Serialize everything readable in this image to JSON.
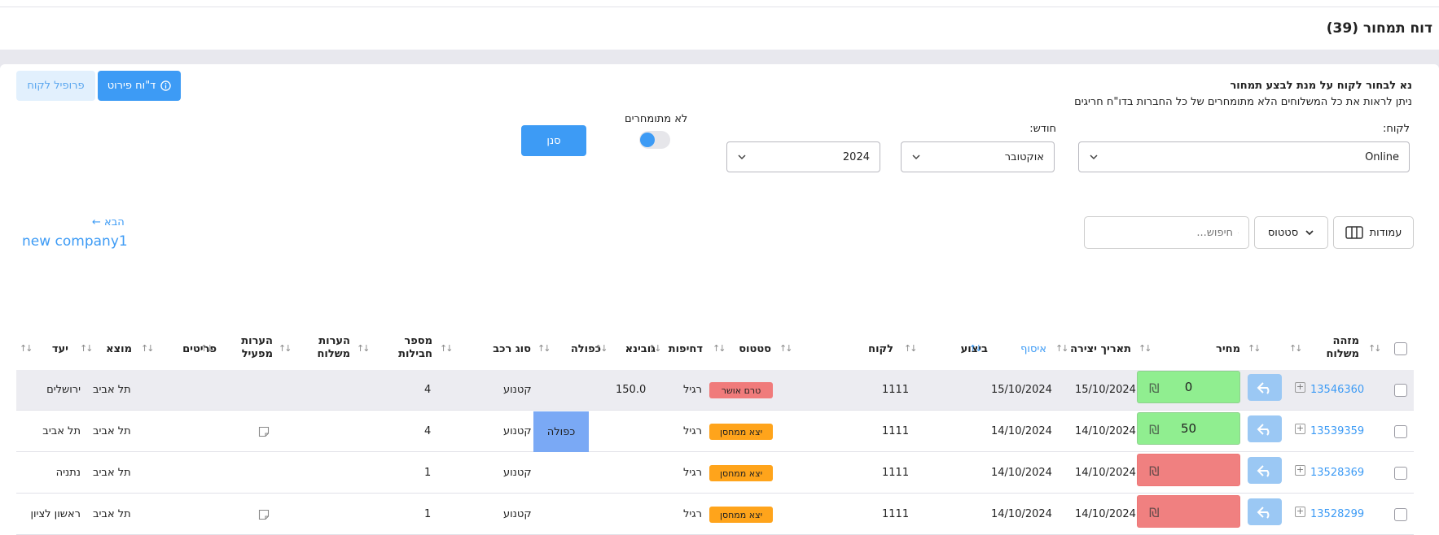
{
  "header": {
    "title": "דוח תמחור (39)"
  },
  "notice": {
    "title": "נא לבחור לקוח על מנת לבצע תמחור",
    "subtitle": "ניתן לראות את כל המשלוחים הלא מתומחרים של כל החברות בדו\"ח חריגים"
  },
  "actions": {
    "details_report": "ד\"וח פירוט",
    "customer_profile": "פרופיל לקוח"
  },
  "filters": {
    "customer_label": "לקוח:",
    "customer_value": "Online",
    "month_label": "חודש:",
    "month_value": "אוקטובר",
    "year_value": "2024",
    "unpriced_label": "לא מתומחרים",
    "filter_button": "סנן"
  },
  "navigation": {
    "next_label": "הבא ←",
    "company_name": "new company1"
  },
  "toolbar": {
    "columns_label": "עמודות",
    "status_label": "סטטוס",
    "search_placeholder": "חיפוש..."
  },
  "table": {
    "headers": {
      "shipment_id_line1": "מזהה",
      "shipment_id_line2": "משלוח",
      "price": "מחיר",
      "created_date": "תאריך יצירה",
      "pickup": "איסוף",
      "execution": "ביצוע",
      "customer": "לקוח",
      "status": "סטטוס",
      "urgency": "דחיפות",
      "height": "גובינא",
      "double": "כפולה",
      "vehicle": "סוג רכב",
      "packages_line1": "מספר",
      "packages_line2": "חבילות",
      "shipment_notes_line1": "הערות",
      "shipment_notes_line2": "משלוח",
      "operator_notes_line1": "הערות",
      "operator_notes_line2": "מפעיל",
      "items": "פריטים",
      "origin": "מוצא",
      "destination": "יעד"
    },
    "rows": [
      {
        "id": "13546360",
        "price": "0",
        "price_state": "green",
        "created": "15/10/2024",
        "pickup": "15/10/2024",
        "customer": "1111",
        "status": "טרם אושר",
        "status_color": "red",
        "urgency": "רגיל",
        "height": "150.0",
        "double": "",
        "vehicle": "קטנוע",
        "packages": "4",
        "origin": "תל אביב",
        "destination": "ירושלים",
        "has_note": false
      },
      {
        "id": "13539359",
        "price": "50",
        "price_state": "green",
        "created": "14/10/2024",
        "pickup": "14/10/2024",
        "customer": "1111",
        "status": "יצא ממחסן",
        "status_color": "orange",
        "urgency": "רגיל",
        "height": "",
        "double": "כפולה",
        "vehicle": "קטנוע",
        "packages": "4",
        "origin": "תל אביב",
        "destination": "תל אביב",
        "has_note": true
      },
      {
        "id": "13528369",
        "price": "",
        "price_state": "red",
        "created": "14/10/2024",
        "pickup": "14/10/2024",
        "customer": "1111",
        "status": "יצא ממחסן",
        "status_color": "orange",
        "urgency": "רגיל",
        "height": "",
        "double": "",
        "vehicle": "קטנוע",
        "packages": "1",
        "origin": "תל אביב",
        "destination": "נתניה",
        "has_note": false
      },
      {
        "id": "13528299",
        "price": "",
        "price_state": "red",
        "created": "14/10/2024",
        "pickup": "14/10/2024",
        "customer": "1111",
        "status": "יצא ממחסן",
        "status_color": "orange",
        "urgency": "רגיל",
        "height": "",
        "double": "",
        "vehicle": "קטנוע",
        "packages": "1",
        "origin": "תל אביב",
        "destination": "ראשון לציון",
        "has_note": true
      }
    ]
  },
  "colors": {
    "primary": "#3d9bf5",
    "price_green": "#90ee90",
    "price_red": "#f08080",
    "badge_red": "#f07b7b",
    "badge_orange": "#ffa41b",
    "double_blue": "#7aa9f5"
  },
  "icons": {
    "info": "info-icon",
    "chevron": "chevron-down-icon",
    "search": "search-icon",
    "columns": "columns-icon",
    "reply": "reply-icon",
    "shekel": "shekel-icon",
    "note": "note-icon",
    "expand": "plus-square-icon"
  }
}
